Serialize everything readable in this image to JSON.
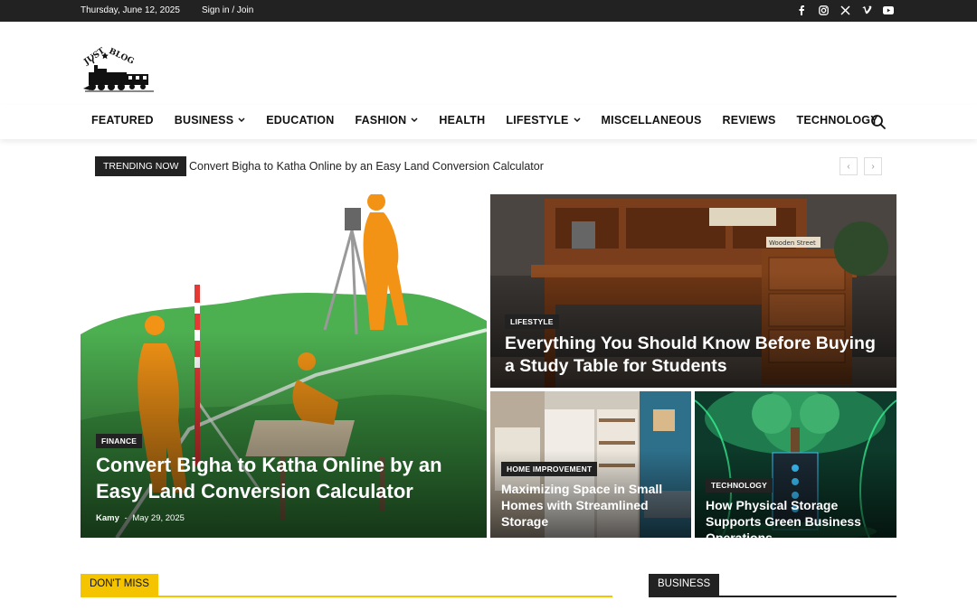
{
  "topbar": {
    "date": "Thursday, June 12, 2025",
    "signin": "Sign in / Join",
    "social": [
      "facebook-icon",
      "instagram-icon",
      "x-icon",
      "vimeo-icon",
      "youtube-icon"
    ]
  },
  "logo": {
    "alt": "Just Blog"
  },
  "nav": {
    "items": [
      {
        "label": "FEATURED",
        "dropdown": false
      },
      {
        "label": "BUSINESS",
        "dropdown": true
      },
      {
        "label": "EDUCATION",
        "dropdown": false
      },
      {
        "label": "FASHION",
        "dropdown": true
      },
      {
        "label": "HEALTH",
        "dropdown": false
      },
      {
        "label": "LIFESTYLE",
        "dropdown": true
      },
      {
        "label": "MISCELLANEOUS",
        "dropdown": false
      },
      {
        "label": "REVIEWS",
        "dropdown": false
      },
      {
        "label": "TECHNOLOGY",
        "dropdown": false
      }
    ]
  },
  "trending": {
    "badge": "TRENDING NOW",
    "headline": "Convert Bigha to Katha Online by an Easy Land Conversion Calculator",
    "prev": "‹",
    "next": "›"
  },
  "featured": {
    "main": {
      "category": "FINANCE",
      "title": "Convert Bigha to Katha Online by an Easy Land Conversion Calculator",
      "author": "Kamy",
      "separator": "-",
      "date": "May 29, 2025"
    },
    "top_right": {
      "category": "LIFESTYLE",
      "title": "Everything You Should Know Before Buying a Study Table for Students",
      "image_text": "Wooden Street"
    },
    "bottom_left": {
      "category": "HOME IMPROVEMENT",
      "title": "Maximizing Space in Small Homes with Streamlined Storage"
    },
    "bottom_right": {
      "category": "TECHNOLOGY",
      "title": "How Physical Storage Supports Green Business Operations"
    }
  },
  "sections": {
    "dont_miss": "DON'T MISS",
    "business": "BUSINESS"
  },
  "colors": {
    "accent_yellow": "#f5c400",
    "dark": "#222222"
  }
}
